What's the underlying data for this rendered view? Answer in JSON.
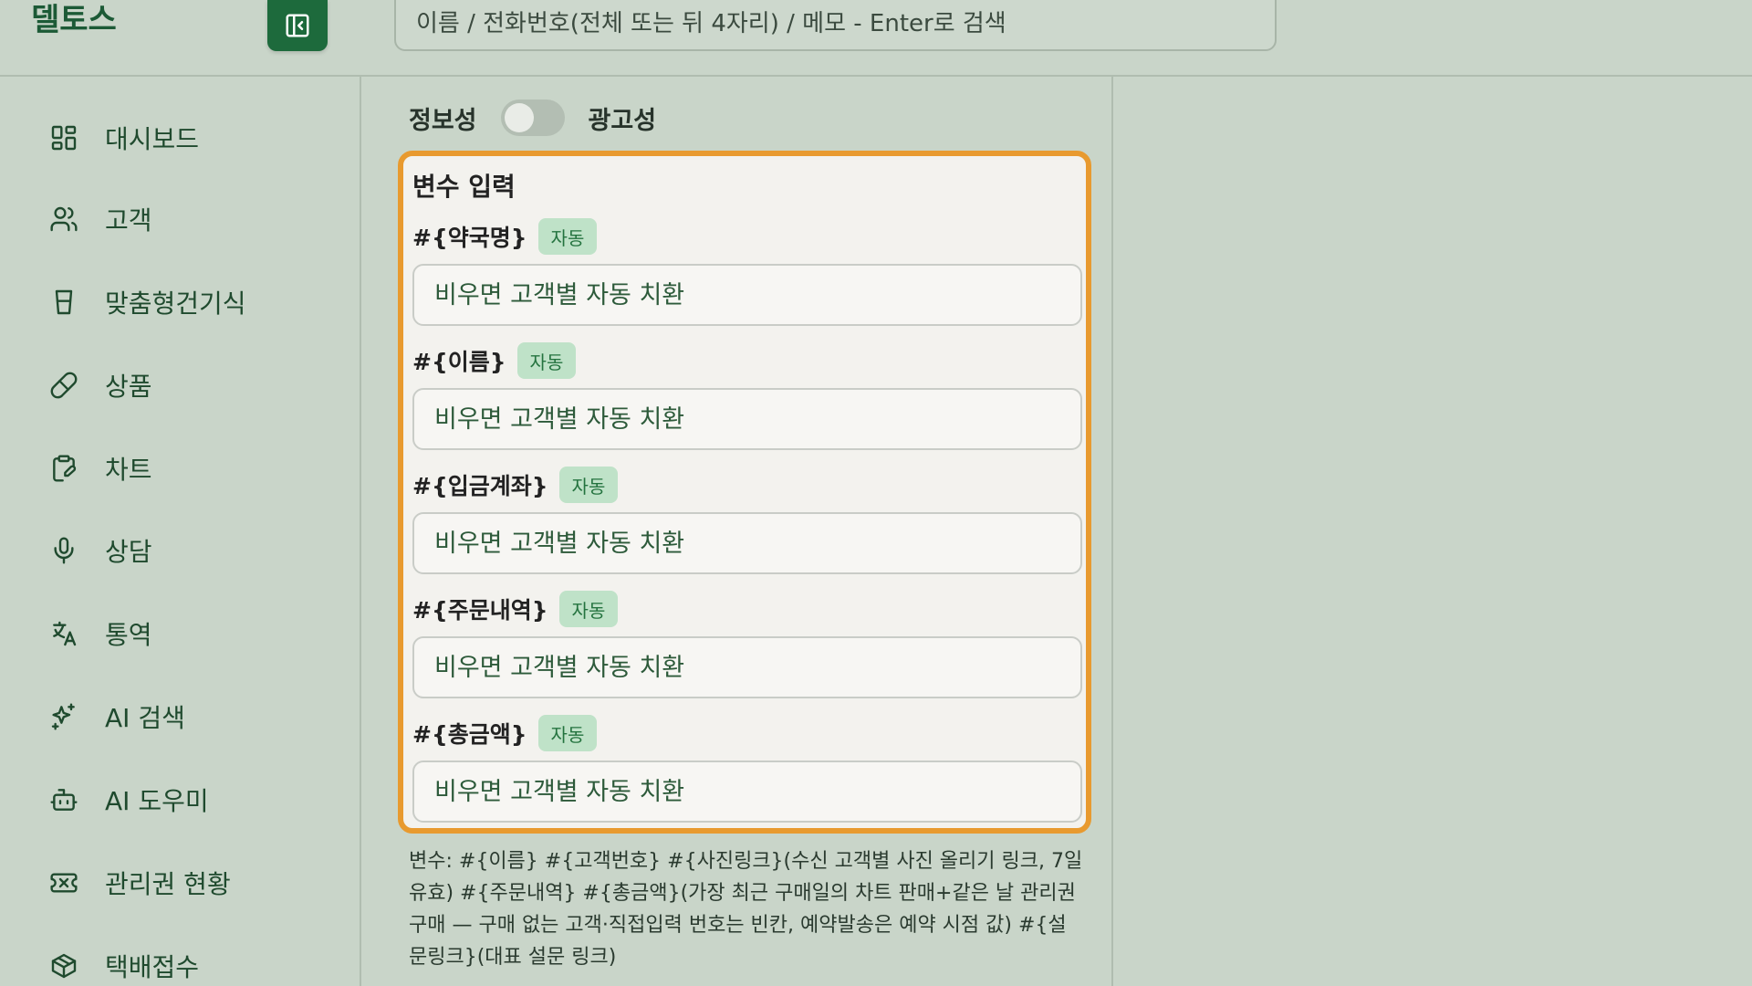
{
  "app": {
    "brand": "델토스"
  },
  "search": {
    "placeholder": "이름 / 전화번호(전체 또는 뒤 4자리) / 메모 - Enter로 검색"
  },
  "sidebar": {
    "items": [
      {
        "label": "대시보드",
        "icon": "dashboard-icon"
      },
      {
        "label": "고객",
        "icon": "users-icon"
      },
      {
        "label": "맞춤형건기식",
        "icon": "cup-icon"
      },
      {
        "label": "상품",
        "icon": "pill-icon"
      },
      {
        "label": "차트",
        "icon": "clipboard-edit-icon"
      },
      {
        "label": "상담",
        "icon": "microphone-icon"
      },
      {
        "label": "통역",
        "icon": "translate-icon"
      },
      {
        "label": "AI 검색",
        "icon": "sparkles-icon"
      },
      {
        "label": "AI 도우미",
        "icon": "bot-icon"
      },
      {
        "label": "관리권 현황",
        "icon": "ticket-icon"
      },
      {
        "label": "택배접수",
        "icon": "package-icon"
      }
    ]
  },
  "message_type": {
    "left_label": "정보성",
    "right_label": "광고성"
  },
  "variables": {
    "title": "변수 입력",
    "badge": "자동",
    "items": [
      {
        "name": "#{약국명}",
        "placeholder": "비우면 고객별 자동 치환"
      },
      {
        "name": "#{이름}",
        "placeholder": "비우면 고객별 자동 치환"
      },
      {
        "name": "#{입금계좌}",
        "placeholder": "비우면 고객별 자동 치환"
      },
      {
        "name": "#{주문내역}",
        "placeholder": "비우면 고객별 자동 치환"
      },
      {
        "name": "#{총금액}",
        "placeholder": "비우면 고객별 자동 치환"
      }
    ]
  },
  "help": {
    "text": "변수: #{이름} #{고객번호} #{사진링크}(수신 고객별 사진 올리기 링크, 7일 유효) #{주문내역} #{총금액}(가장 최근 구매일의 차트 판매+같은 날 관리권 구매 — 구매 없는 고객·직접입력 번호는 빈칸, 예약발송은 예약 시점 값) #{설문링크}(대표 설문 링크)"
  },
  "colors": {
    "background": "#c9d5c9",
    "accent": "#1d6a3c",
    "highlight_border": "#e89a2f",
    "badge_bg": "#bfe2c8"
  }
}
